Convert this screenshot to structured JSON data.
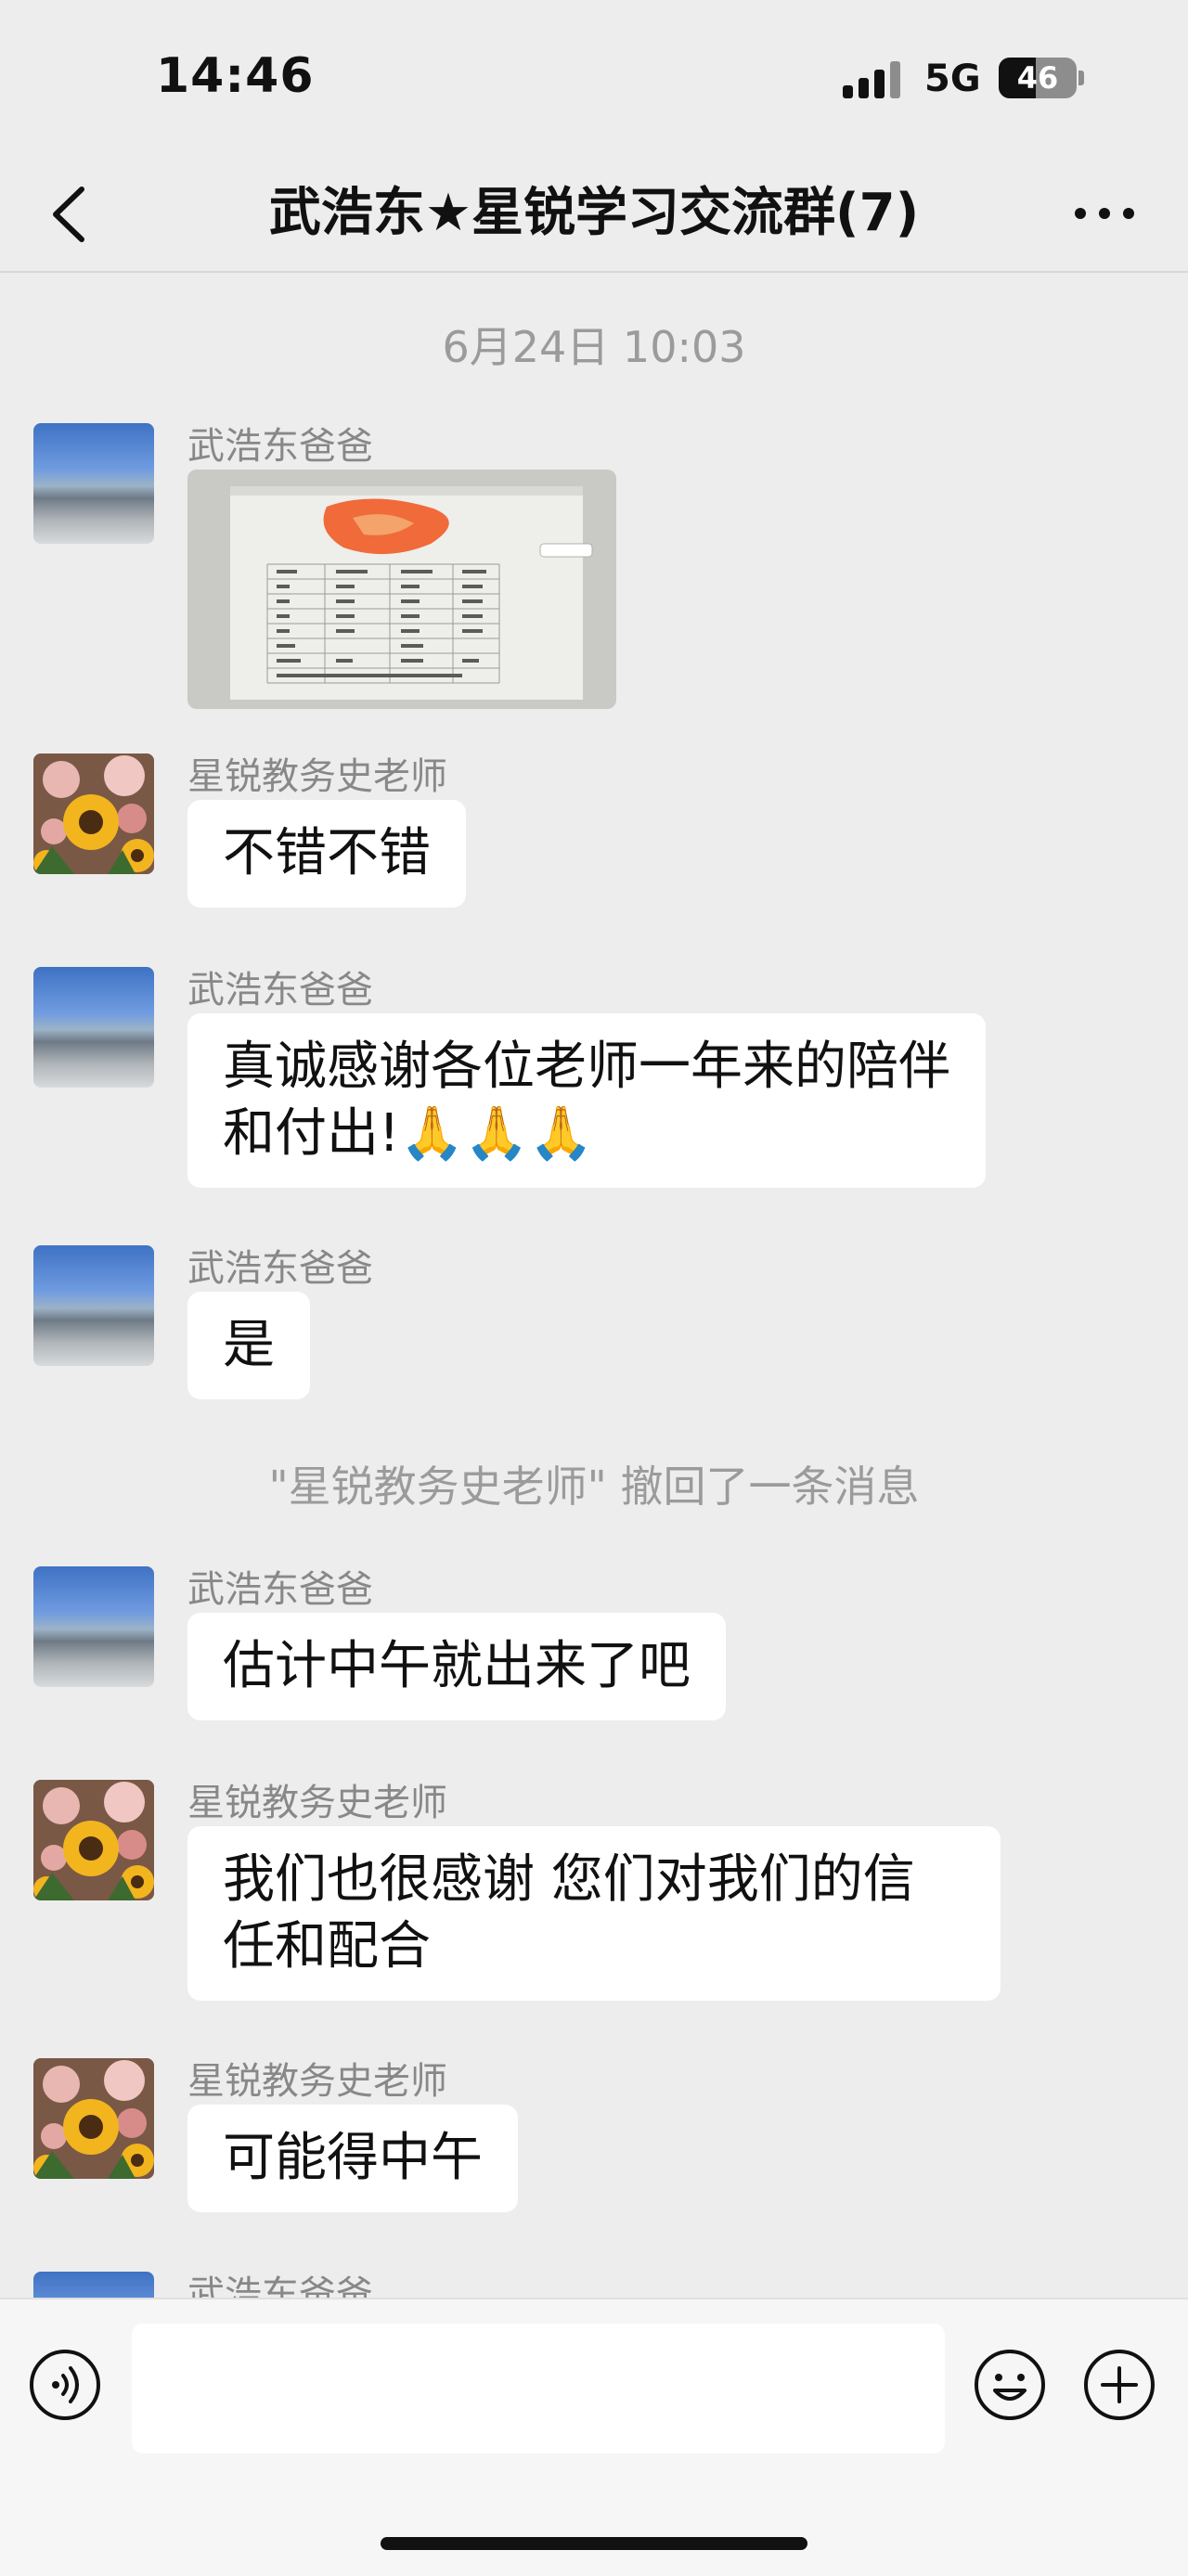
{
  "status_bar": {
    "time": "14:46",
    "network": "5G",
    "battery": "46"
  },
  "header": {
    "title": "武浩东★星锐学习交流群(7)"
  },
  "divider_time": "6月24日 10:03",
  "messages": [
    {
      "sender": "武浩东爸爸",
      "type": "image",
      "avatar": "building-avatar"
    },
    {
      "sender": "星锐教务史老师",
      "text": "不错不错",
      "avatar": "flowers-avatar"
    },
    {
      "sender": "武浩东爸爸",
      "text": "真诚感谢各位老师一年来的陪伴和付出!🙏🙏🙏",
      "avatar": "building-avatar"
    },
    {
      "sender": "武浩东爸爸",
      "text": "是",
      "avatar": "building-avatar"
    },
    {
      "sender": "武浩东爸爸",
      "text": "估计中午就出来了吧",
      "avatar": "building-avatar"
    },
    {
      "sender": "星锐教务史老师",
      "text": "我们也很感谢 您们对我们的信任和配合",
      "avatar": "flowers-avatar"
    },
    {
      "sender": "星锐教务史老师",
      "text": "可能得中午",
      "avatar": "flowers-avatar"
    },
    {
      "sender": "武浩东爸爸",
      "avatar": "building-avatar"
    }
  ],
  "system_notice": "\"星锐教务史老师\" 撤回了一条消息",
  "input_bar": {
    "placeholder": "",
    "icons": [
      "voice-icon",
      "emoji-icon",
      "plus-icon"
    ]
  },
  "colors": {
    "background": "#ededed",
    "bubble": "#ffffff",
    "meta_text": "#9b9b9b"
  }
}
